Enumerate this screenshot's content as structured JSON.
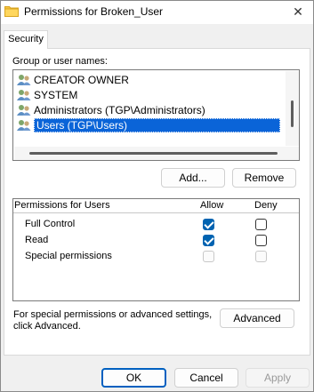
{
  "window": {
    "title": "Permissions for Broken_User",
    "close_glyph": "✕"
  },
  "tabs": [
    {
      "label": "Security"
    }
  ],
  "group": {
    "label": "Group or user names:",
    "items": [
      {
        "name": "CREATOR OWNER",
        "icon": "users-icon",
        "selected": false
      },
      {
        "name": "SYSTEM",
        "icon": "users-icon",
        "selected": false
      },
      {
        "name": "Administrators (TGP\\Administrators)",
        "icon": "users-icon",
        "selected": false
      },
      {
        "name": "Users (TGP\\Users)",
        "icon": "users-icon",
        "selected": true
      }
    ],
    "add_label": "Add...",
    "remove_label": "Remove"
  },
  "permissions": {
    "header": "Permissions for Users",
    "allow_header": "Allow",
    "deny_header": "Deny",
    "rows": [
      {
        "name": "Full Control",
        "allow": "checked",
        "deny": "unchecked"
      },
      {
        "name": "Read",
        "allow": "checked",
        "deny": "unchecked"
      },
      {
        "name": "Special permissions",
        "allow": "disabled",
        "deny": "disabled"
      }
    ]
  },
  "advanced": {
    "text_line1": "For special permissions or advanced settings,",
    "text_line2": "click Advanced.",
    "button_label": "Advanced"
  },
  "footer": {
    "ok_label": "OK",
    "cancel_label": "Cancel",
    "apply_label": "Apply"
  },
  "colors": {
    "selection": "#0a64d8",
    "checkbox_accent": "#0063b1",
    "default_button_border": "#0060c0"
  }
}
